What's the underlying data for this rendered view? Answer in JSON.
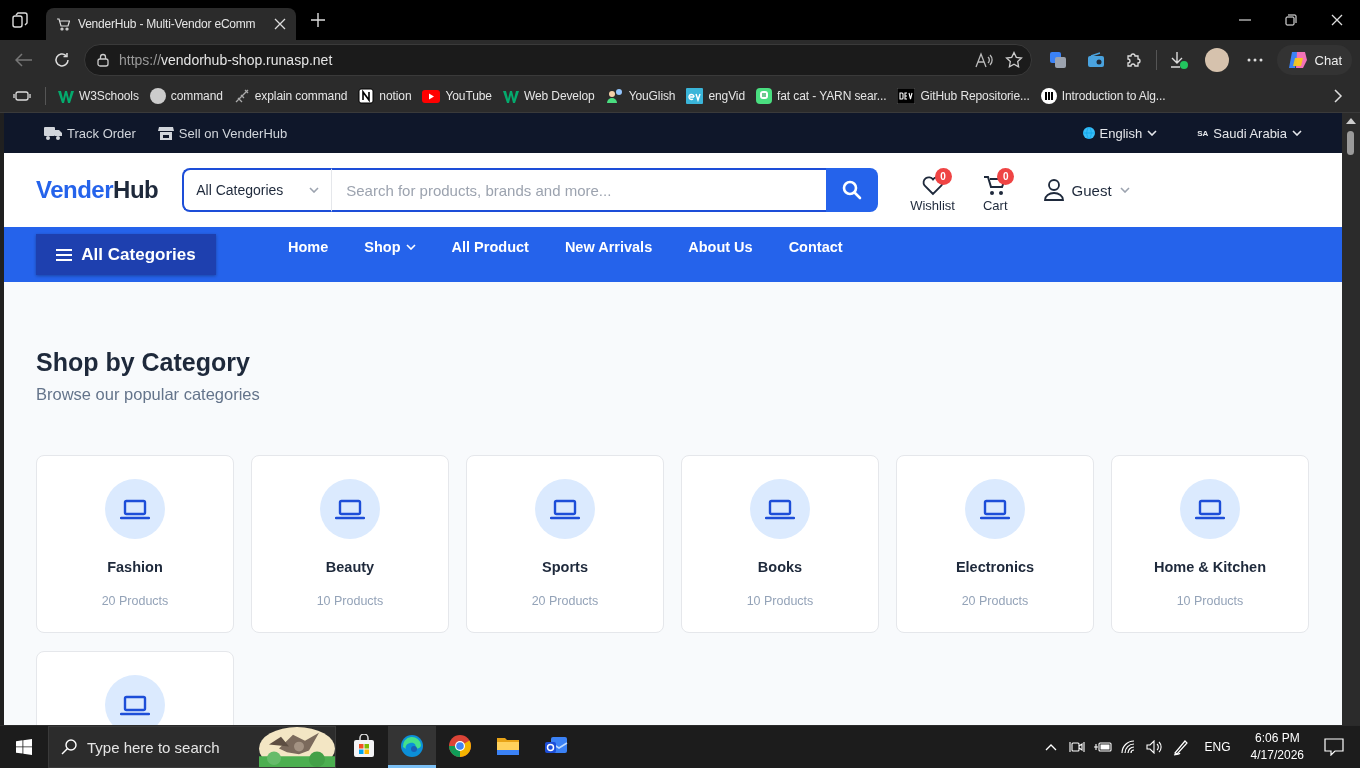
{
  "browser": {
    "tab": {
      "title": "VenderHub - Multi-Vendor eComm"
    },
    "address": {
      "scheme": "https://",
      "host": "vendorhub-shop.runasp.net"
    },
    "chat_button": "Chat",
    "bookmarks": [
      {
        "label": "W3Schools",
        "kind": "w3"
      },
      {
        "label": "command",
        "kind": "circle"
      },
      {
        "label": "explain command",
        "kind": "sketch"
      },
      {
        "label": "notion",
        "kind": "notion"
      },
      {
        "label": "YouTube",
        "kind": "youtube"
      },
      {
        "label": "Web Develop",
        "kind": "w3"
      },
      {
        "label": "YouGlish",
        "kind": "people"
      },
      {
        "label": "engVid",
        "kind": "engvid"
      },
      {
        "label": "fat cat - YARN sear...",
        "kind": "yarn"
      },
      {
        "label": "GitHub Repositorie...",
        "kind": "dev"
      },
      {
        "label": "Introduction to Alg...",
        "kind": "bars"
      }
    ]
  },
  "site": {
    "top_bar": {
      "links": [
        {
          "label": "Track Order",
          "kind": "truck"
        },
        {
          "label": "Sell on VenderHub",
          "kind": "store"
        }
      ],
      "language": "English",
      "region": {
        "code": "SA",
        "label": "Saudi Arabia"
      }
    },
    "header": {
      "logo": {
        "part_1": "Vender",
        "part_2": "Hub"
      },
      "category_select": "All Categories",
      "search": {
        "placeholder": "Search for products, brands and more..."
      },
      "wishlist": {
        "label": "Wishlist",
        "count": "0"
      },
      "cart": {
        "label": "Cart",
        "count": "0"
      },
      "account": "Guest"
    },
    "nav": {
      "all_categories": "All Categories",
      "links": [
        {
          "label": "Home",
          "dropdown": false
        },
        {
          "label": "Shop",
          "dropdown": true
        },
        {
          "label": "All Product",
          "dropdown": false
        },
        {
          "label": "New Arrivals",
          "dropdown": false
        },
        {
          "label": "About Us",
          "dropdown": false
        },
        {
          "label": "Contact",
          "dropdown": false
        }
      ]
    },
    "section": {
      "title": "Shop by Category",
      "subtitle": "Browse our popular categories",
      "categories": [
        {
          "name": "Fashion",
          "count": "20 Products"
        },
        {
          "name": "Beauty",
          "count": "10 Products"
        },
        {
          "name": "Sports",
          "count": "20 Products"
        },
        {
          "name": "Books",
          "count": "10 Products"
        },
        {
          "name": "Electronics",
          "count": "20 Products"
        },
        {
          "name": "Home & Kitchen",
          "count": "10 Products"
        }
      ],
      "more_cards_below": true
    }
  },
  "taskbar": {
    "search": {
      "placeholder": "Type here to search"
    },
    "apps": [
      {
        "kind": "store",
        "selected": false
      },
      {
        "kind": "edge",
        "selected": true
      },
      {
        "kind": "chrome",
        "selected": false
      },
      {
        "kind": "folder",
        "selected": false
      },
      {
        "kind": "mail",
        "selected": false
      }
    ],
    "language": "ENG",
    "time": "6:06 PM",
    "date": "4/17/2026"
  }
}
